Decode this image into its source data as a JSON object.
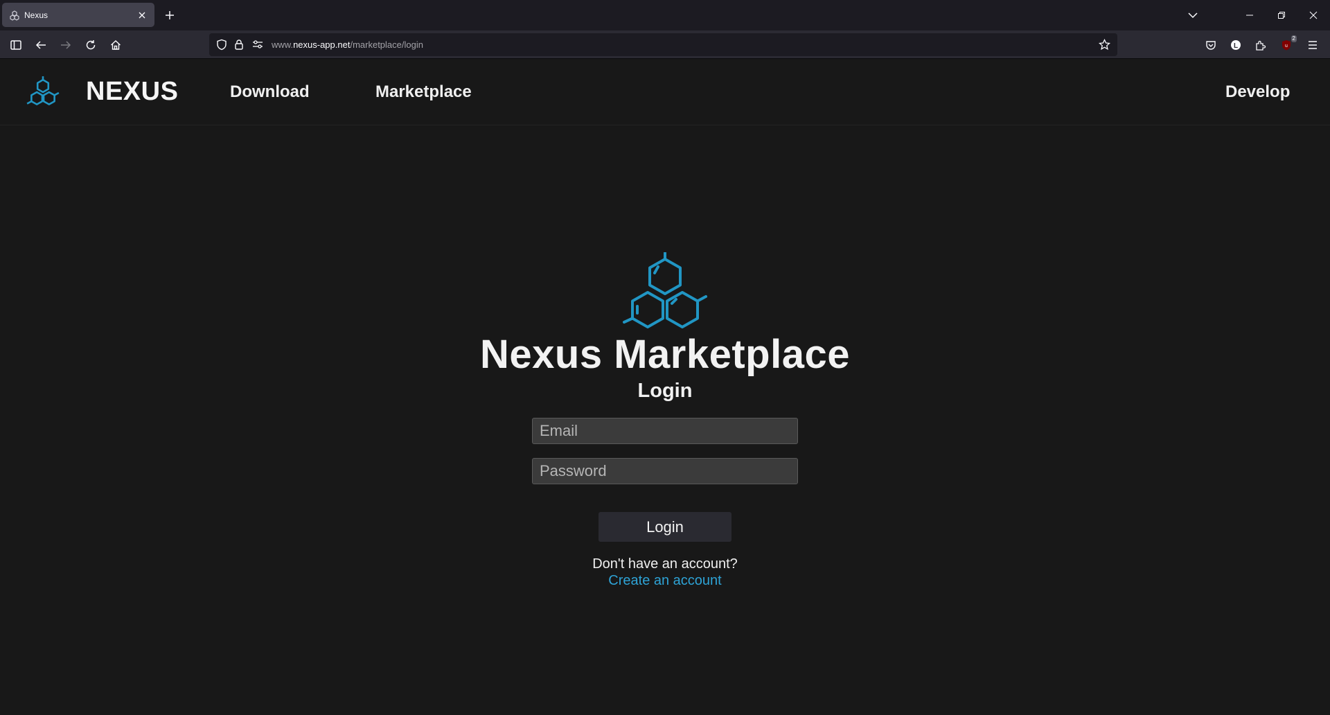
{
  "browser": {
    "tab_title": "Nexus",
    "url_prefix": "www.",
    "url_host": "nexus-app.net",
    "url_path": "/marketplace/login",
    "extension_badge": "2"
  },
  "header": {
    "brand": "NEXUS",
    "nav": [
      {
        "label": "Download"
      },
      {
        "label": "Marketplace"
      },
      {
        "label": "Develop"
      }
    ]
  },
  "login": {
    "title": "Nexus Marketplace",
    "subtitle": "Login",
    "email_placeholder": "Email",
    "password_placeholder": "Password",
    "button_label": "Login",
    "no_account_text": "Don't have an account?",
    "create_account_link": "Create an account"
  },
  "colors": {
    "accent": "#2196c4",
    "background": "#181818"
  }
}
